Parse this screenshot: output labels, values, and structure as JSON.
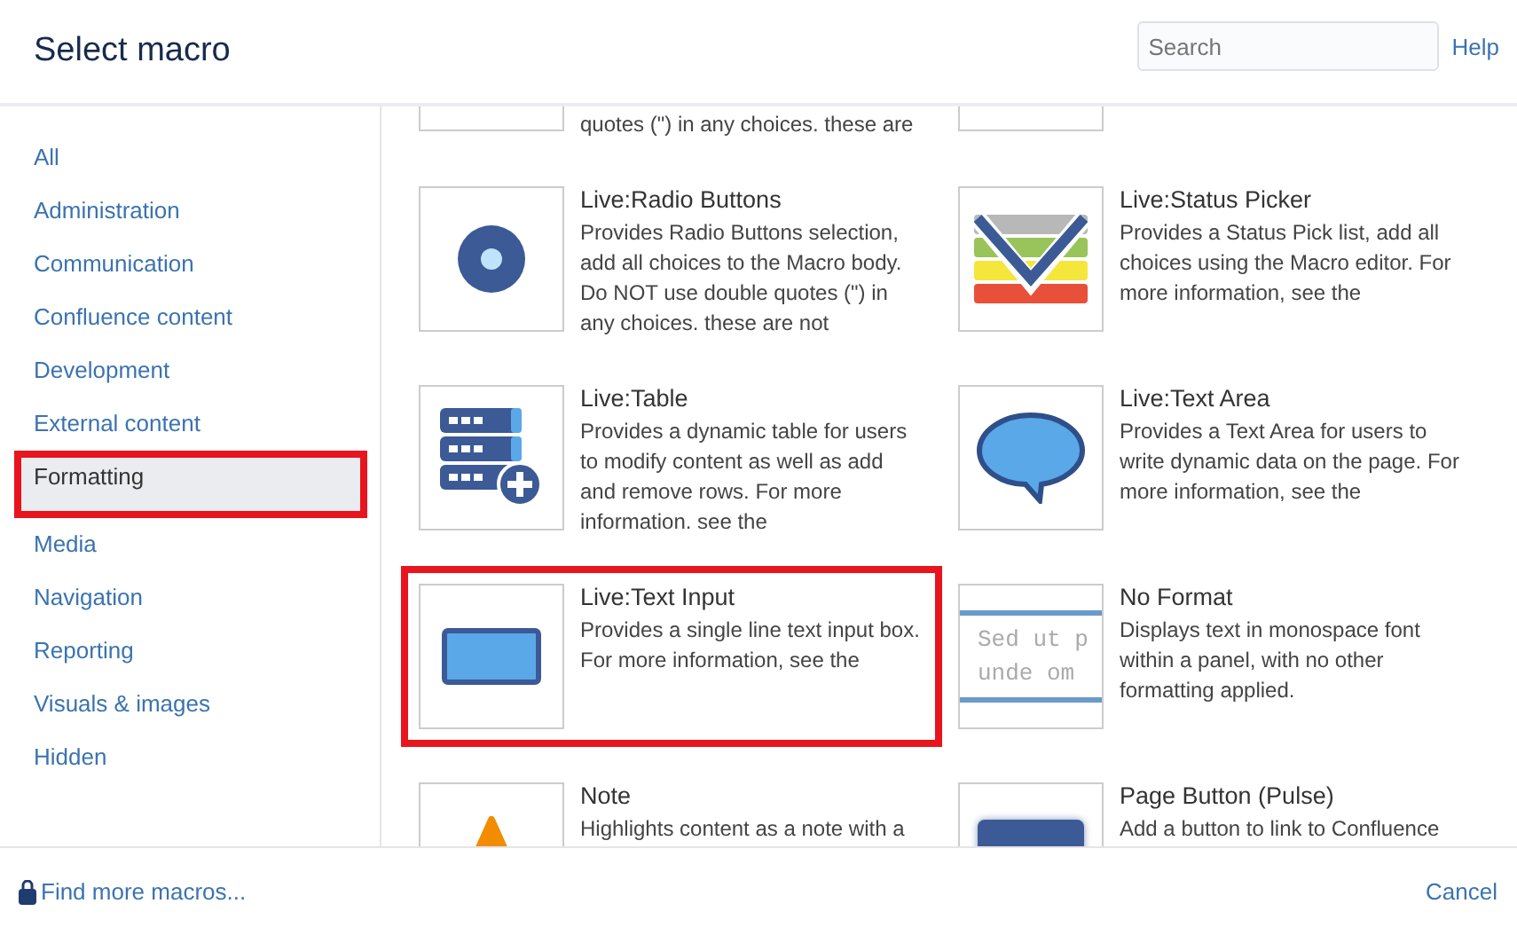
{
  "dialog": {
    "title": "Select macro",
    "search": {
      "placeholder": "Search"
    },
    "help": "Help"
  },
  "categories": [
    {
      "label": "All",
      "selected": false
    },
    {
      "label": "Administration",
      "selected": false
    },
    {
      "label": "Communication",
      "selected": false
    },
    {
      "label": "Confluence content",
      "selected": false
    },
    {
      "label": "Development",
      "selected": false
    },
    {
      "label": "External content",
      "selected": false
    },
    {
      "label": "Formatting",
      "selected": true
    },
    {
      "label": "Media",
      "selected": false
    },
    {
      "label": "Navigation",
      "selected": false
    },
    {
      "label": "Reporting",
      "selected": false
    },
    {
      "label": "Visuals & images",
      "selected": false
    },
    {
      "label": "Hidden",
      "selected": false
    }
  ],
  "partial_row": {
    "description": "quotes (\") in any choices. these are"
  },
  "macros": [
    {
      "kind": "radio",
      "title": "Live:Radio Buttons",
      "description": "Provides Radio Buttons selection, add all choices to the Macro body. Do NOT use double quotes (\") in any choices. these are not",
      "selected": false
    },
    {
      "kind": "status",
      "title": "Live:Status Picker",
      "description": "Provides a Status Pick list, add all choices using the Macro editor. For more information, see the",
      "selected": false
    },
    {
      "kind": "table",
      "title": "Live:Table",
      "description": "Provides a dynamic table for users to modify content as well as add and remove rows. For more information. see the",
      "selected": false
    },
    {
      "kind": "bubble",
      "title": "Live:Text Area",
      "description": "Provides a Text Area for users to write dynamic data on the page. For more information, see the",
      "selected": false
    },
    {
      "kind": "input",
      "title": "Live:Text Input",
      "description": "Provides a single line text input box. For more information, see the",
      "selected": true
    },
    {
      "kind": "mono",
      "title": "No Format",
      "description": "Displays text in monospace font within a panel, with no other formatting applied.",
      "preview_lines": [
        "Sed ut p",
        "unde om"
      ],
      "selected": false
    },
    {
      "kind": "note",
      "title": "Note",
      "description": "Highlights content as a note with a",
      "selected": false
    },
    {
      "kind": "button",
      "title": "Page Button (Pulse)",
      "description": "Add a button to link to Confluence",
      "selected": false
    }
  ],
  "footer": {
    "find_more": "Find more macros...",
    "cancel": "Cancel"
  }
}
